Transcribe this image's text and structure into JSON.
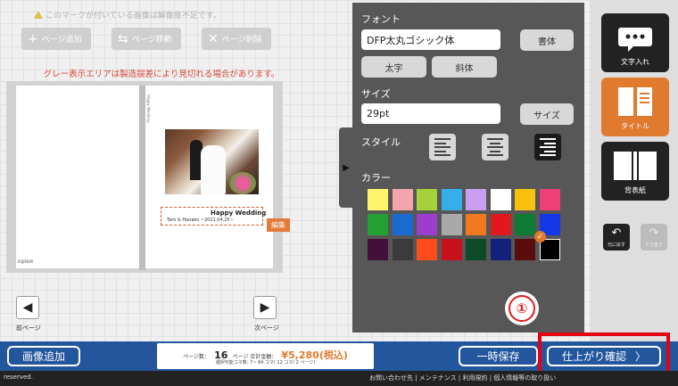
{
  "top": {
    "warning": "このマークが付いている画像は解像度不足です。",
    "buttons": [
      {
        "icon": "+",
        "label": "ページ追加"
      },
      {
        "icon": "⇆",
        "label": "ページ移動"
      },
      {
        "icon": "✕",
        "label": "ページ削除"
      }
    ],
    "notice": "グレー表示エリアは製造誤差により見切れる場合があります。"
  },
  "spread": {
    "spine_text": "Happy Wedding",
    "logo_text": "FUJIFILM",
    "title_main": "Happy Wedding",
    "title_sub": "Taro & Hanako ~2021.04.25~",
    "edit_label": "編集"
  },
  "nav": {
    "prev_label": "前ページ",
    "next_label": "次ページ"
  },
  "panel": {
    "font_label": "フォント",
    "font_value": "DFP太丸ゴシック体",
    "typeface_button": "書体",
    "bold_button": "太字",
    "italic_button": "斜体",
    "size_label": "サイズ",
    "size_value": "29pt",
    "size_button": "サイズ",
    "style_label": "スタイル",
    "color_label": "カラー",
    "help_number": "①",
    "colors": [
      "#fff56a",
      "#f4a4ac",
      "#a5d238",
      "#35aeea",
      "#c9a0f1",
      "#ffffff",
      "#f8c10e",
      "#ef3f79",
      "#22a031",
      "#1a6bd1",
      "#9b3dcf",
      "#a9a9a9",
      "#f37920",
      "#e2181f",
      "#0f7a31",
      "#1438e8",
      "#43103c",
      "#3b3b3b",
      "#ff4a1c",
      "#c80f1c",
      "#0d4a27",
      "#13207c",
      "#5b0d0d",
      "#000000"
    ],
    "selected_color": "#000000"
  },
  "sidebar": {
    "text_label": "文字入れ",
    "title_label": "タイトル",
    "cover_label": "背表紙",
    "undo_label": "元に戻す",
    "redo_label": "やり直す"
  },
  "bottom": {
    "add_image": "画像追加",
    "pages_prefix": "ページ数：",
    "pages_value": "16",
    "pages_suffix": "ページ 合計金額：",
    "total": "¥5,280(税込)",
    "selectable": "選択可能コマ数: 7~ 84 コマ( 12 コマ/ 2 ページ)",
    "save": "一時保存",
    "confirm": "仕上がり確認",
    "footer_left": "reserved.",
    "footer_links": "お問い合わせ先 | メンテナンス | 利用規約 | 個人情報等の取り扱い"
  }
}
